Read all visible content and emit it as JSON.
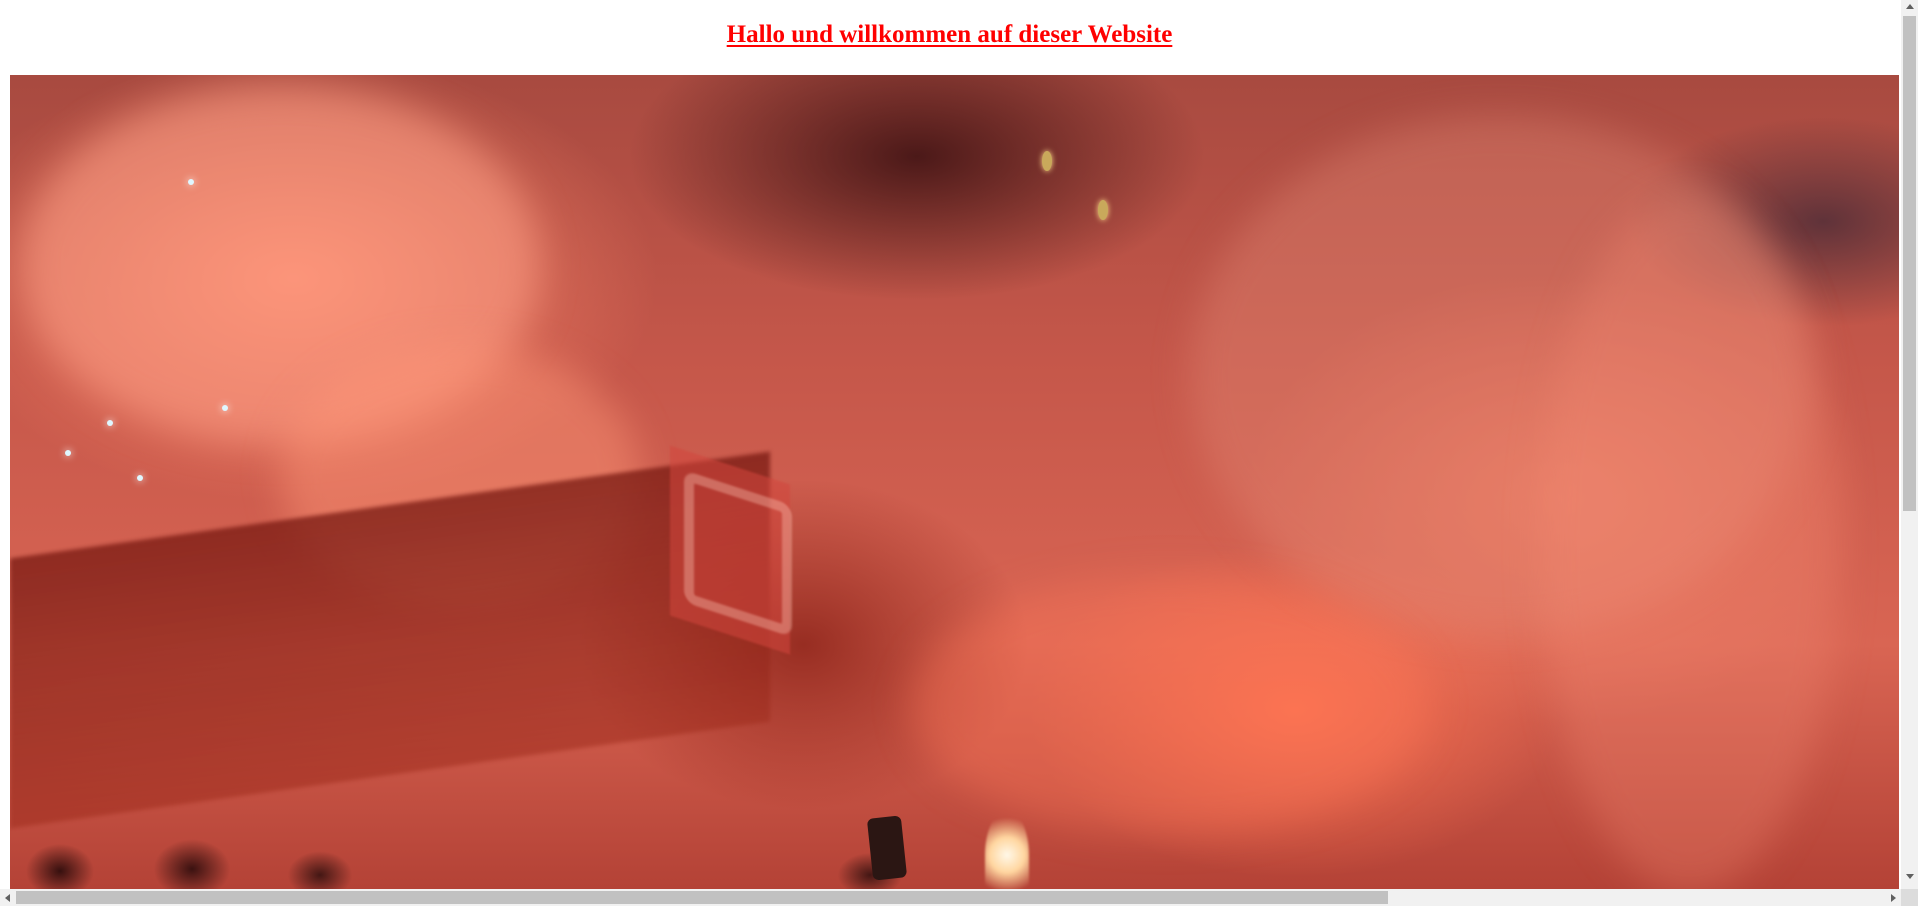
{
  "page": {
    "heading": "Hallo und willkommen auf dieser Website"
  },
  "colors": {
    "heading": "#ff0000",
    "background": "#ffffff",
    "scrollbar_track": "#f1f1f1",
    "scrollbar_thumb": "#c1c1c1"
  },
  "scroll": {
    "vertical_fraction_visible": 0.56,
    "horizontal_fraction_visible": 0.72
  },
  "icons": [
    "scroll-up-arrow-icon",
    "scroll-down-arrow-icon",
    "scroll-left-arrow-icon",
    "scroll-right-arrow-icon"
  ]
}
